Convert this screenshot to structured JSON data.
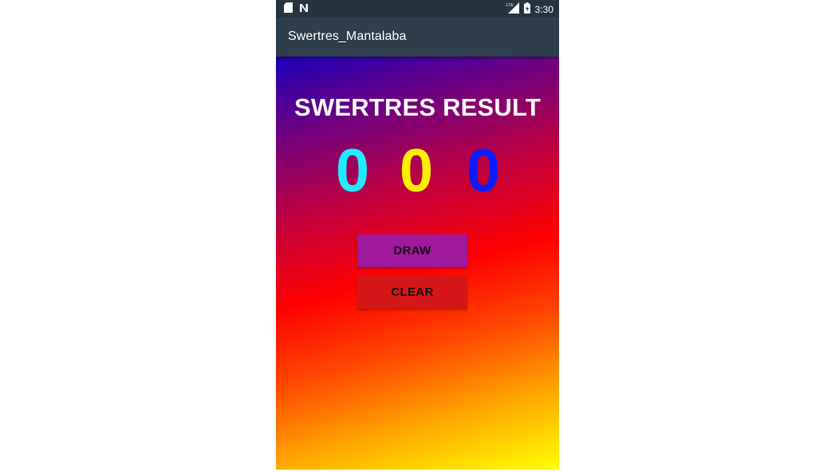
{
  "status_bar": {
    "time": "3:30",
    "network_label": "LTE"
  },
  "app_bar": {
    "title": "Swertres_Mantalaba"
  },
  "main": {
    "heading": "SWERTRES RESULT",
    "digits": [
      "0",
      "0",
      "0"
    ],
    "draw_label": "DRAW",
    "clear_label": "CLEAR"
  },
  "colors": {
    "digit_1": "#22eaff",
    "digit_2": "#ffee00",
    "digit_3": "#0a1cff",
    "draw_button": "#a0189c",
    "clear_button": "#d51616",
    "app_bar": "#2f3e4d"
  },
  "icons": {
    "status_left": [
      "sd-card-icon",
      "n-notification-icon"
    ],
    "status_right": [
      "lte-signal-icon",
      "battery-icon"
    ]
  }
}
